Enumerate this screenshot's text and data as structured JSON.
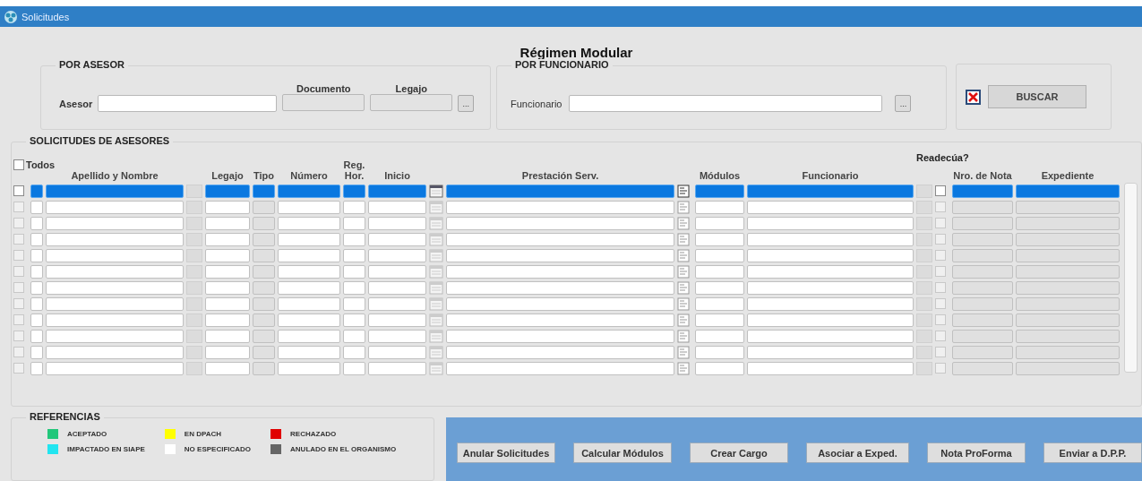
{
  "window": {
    "title": "Solicitudes"
  },
  "form_title": "Régimen Modular",
  "por_asesor": {
    "legend": "POR ASESOR",
    "asesor_label": "Asesor",
    "documento_label": "Documento",
    "legajo_label": "Legajo",
    "lookup": "..."
  },
  "por_funcionario": {
    "legend": "POR FUNCIONARIO",
    "funcionario_label": "Funcionario",
    "lookup": "..."
  },
  "search": {
    "clear_checked": true,
    "button": "BUSCAR"
  },
  "solicitudes": {
    "legend": "SOLICITUDES DE ASESORES",
    "todos": {
      "label": "Todos",
      "checked": false
    },
    "readecua_label": "Readecúa?",
    "columns": [
      "Apellido y Nombre",
      "Legajo",
      "Tipo",
      "Número",
      "Reg.\nHor.",
      "Inicio",
      "Prestación Serv.",
      "Módulos",
      "Funcionario",
      "Nro. de Nota",
      "Expediente"
    ],
    "rows": [
      {
        "selected": true,
        "checked": false,
        "readecua": false
      },
      {
        "selected": false,
        "checked": false,
        "readecua": false
      },
      {
        "selected": false,
        "checked": false,
        "readecua": false
      },
      {
        "selected": false,
        "checked": false,
        "readecua": false
      },
      {
        "selected": false,
        "checked": false,
        "readecua": false
      },
      {
        "selected": false,
        "checked": false,
        "readecua": false
      },
      {
        "selected": false,
        "checked": false,
        "readecua": false
      },
      {
        "selected": false,
        "checked": false,
        "readecua": false
      },
      {
        "selected": false,
        "checked": false,
        "readecua": false
      },
      {
        "selected": false,
        "checked": false,
        "readecua": false
      },
      {
        "selected": false,
        "checked": false,
        "readecua": false
      },
      {
        "selected": false,
        "checked": false,
        "readecua": false
      }
    ]
  },
  "references": {
    "legend": "REFERENCIAS",
    "items": [
      {
        "label": "ACEPTADO",
        "color": "#22c77a"
      },
      {
        "label": "EN DPACH",
        "color": "#ffff00"
      },
      {
        "label": "RECHAZADO",
        "color": "#e00000"
      },
      {
        "label": "IMPACTADO EN SIAPE",
        "color": "#22e5f0"
      },
      {
        "label": "NO ESPECIFICADO",
        "color": "#ffffff"
      },
      {
        "label": "ANULADO EN EL ORGANISMO",
        "color": "#666666"
      }
    ]
  },
  "actions": [
    "Anular Solicitudes",
    "Calcular Módulos",
    "Crear Cargo",
    "Asociar a Exped.",
    "Nota ProForma",
    "Enviar a D.P.P."
  ]
}
